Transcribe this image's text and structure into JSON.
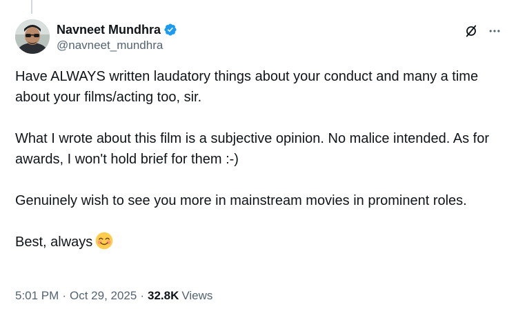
{
  "author": {
    "display_name": "Navneet Mundhra",
    "handle": "@navneet_mundhra",
    "verified": true,
    "verified_color": "#1d9bf0"
  },
  "actions": {
    "grok_icon": "grok-icon",
    "more_icon": "more-icon"
  },
  "tweet": {
    "paragraphs": [
      "Have ALWAYS written laudatory things about your conduct and many a time about your films/acting too, sir.",
      "What I wrote about this film is a subjective opinion. No malice intended. As for awards, I won't hold brief for them :-)",
      "Genuinely wish to see you more in mainstream movies in prominent roles.",
      "Best, always"
    ],
    "emoji": "smiling-face-with-smiling-eyes"
  },
  "meta": {
    "time": "5:01 PM",
    "separator": "·",
    "date": "Oct 29, 2025",
    "views_count": "32.8K",
    "views_label": "Views"
  },
  "colors": {
    "text_primary": "#0f1419",
    "text_secondary": "#536471",
    "thread_line": "#cfd9de"
  }
}
